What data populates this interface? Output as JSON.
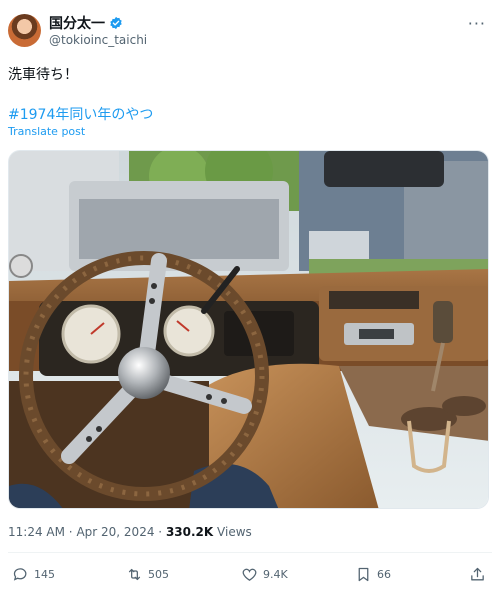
{
  "author": {
    "display_name": "国分太一",
    "handle": "@tokioinc_taichi",
    "verified": true
  },
  "tweet": {
    "text": "洗車待ち！",
    "hashtag": "#1974年同い年のやつ",
    "translate_label": "Translate post"
  },
  "meta": {
    "time": "11:24 AM",
    "separator": "·",
    "date": "Apr 20, 2024",
    "views_count": "330.2K",
    "views_label": "Views"
  },
  "actions": {
    "reply_count": "145",
    "repost_count": "505",
    "like_count": "9.4K",
    "bookmark_count": "66"
  },
  "icons": [
    "more-icon",
    "verified-icon",
    "reply-icon",
    "repost-icon",
    "like-icon",
    "bookmark-icon",
    "share-icon"
  ],
  "colors": {
    "accent": "#1d9bf0",
    "text_secondary": "#536471",
    "text_primary": "#0f1419"
  }
}
